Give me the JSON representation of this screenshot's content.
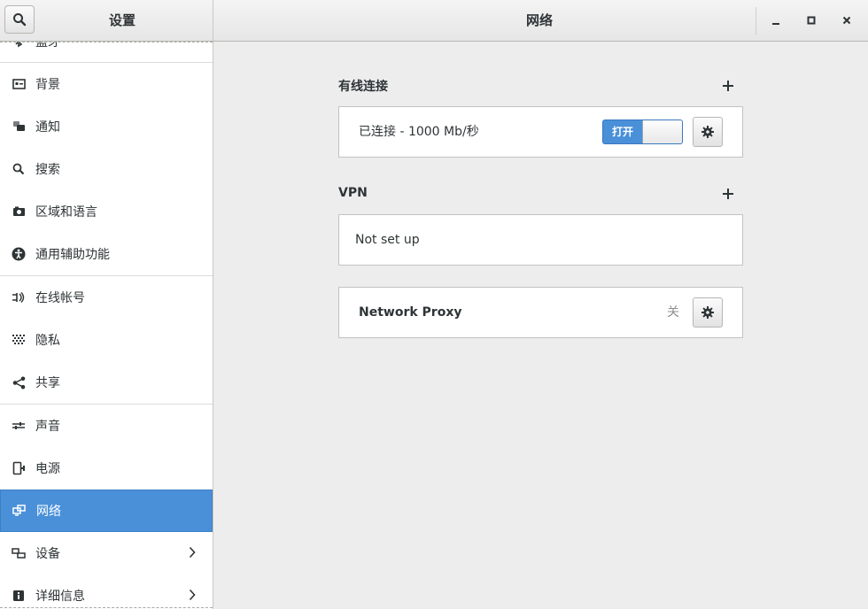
{
  "header": {
    "sidebar_title": "设置",
    "panel_title": "网络"
  },
  "sidebar": {
    "partial_top_item": "蓝牙",
    "items": [
      {
        "label": "背景",
        "icon": "background-icon"
      },
      {
        "label": "通知",
        "icon": "notification-icon"
      },
      {
        "label": "搜索",
        "icon": "search-icon"
      },
      {
        "label": "区域和语言",
        "icon": "region-language-icon"
      },
      {
        "label": "通用辅助功能",
        "icon": "accessibility-icon"
      },
      {
        "label": "在线帐号",
        "icon": "online-accounts-icon"
      },
      {
        "label": "隐私",
        "icon": "privacy-icon"
      },
      {
        "label": "共享",
        "icon": "share-icon"
      },
      {
        "label": "声音",
        "icon": "sound-icon"
      },
      {
        "label": "电源",
        "icon": "power-icon"
      },
      {
        "label": "网络",
        "icon": "network-icon",
        "selected": true
      },
      {
        "label": "设备",
        "icon": "devices-icon",
        "has_submenu": true
      },
      {
        "label": "详细信息",
        "icon": "details-icon",
        "has_submenu": true
      }
    ]
  },
  "wired": {
    "title": "有线连接",
    "status": "已连接 - 1000 Mb/秒",
    "switch_label": "打开"
  },
  "vpn": {
    "title": "VPN",
    "status": "Not set up"
  },
  "proxy": {
    "title": "Network Proxy",
    "status": "关"
  },
  "colors": {
    "accent": "#4a90d9",
    "background": "#ededed",
    "panel": "#ffffff"
  }
}
